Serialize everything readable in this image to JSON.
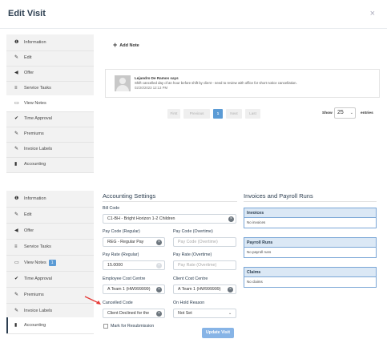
{
  "modal": {
    "title": "Edit Visit",
    "close": "×"
  },
  "sidebar_top": {
    "items": [
      {
        "icon": "info-icon",
        "glyph": "❶",
        "label": "Information"
      },
      {
        "icon": "pencil-icon",
        "glyph": "✎",
        "label": "Edit"
      },
      {
        "icon": "offer-icon",
        "glyph": "◀",
        "label": "Offer"
      },
      {
        "icon": "list-icon",
        "glyph": "≡",
        "label": "Service Tasks"
      },
      {
        "icon": "comments-icon",
        "glyph": "▭",
        "label": "View Notes"
      },
      {
        "icon": "check-icon",
        "glyph": "✔",
        "label": "Time Approval"
      },
      {
        "icon": "pencil-icon",
        "glyph": "✎",
        "label": "Premiums"
      },
      {
        "icon": "pencil-icon",
        "glyph": "✎",
        "label": "Invoice Labels"
      },
      {
        "icon": "bar-chart-icon",
        "glyph": "▮",
        "label": "Accounting"
      }
    ],
    "active_index": 4
  },
  "notes": {
    "add_label": "Add Note",
    "author": "Lejandro De Ramos says",
    "text": "Shift cancelled day of an hour before shift by client - need to review with office for short notice cancellation.",
    "date": "02/20/2023 12:13 PM"
  },
  "pagination": {
    "first": "First",
    "previous": "Previous",
    "current": "1",
    "next": "Next",
    "last": "Last",
    "show_label": "Show",
    "page_size": "25",
    "entries_label": "entries"
  },
  "sidebar_bottom": {
    "items": [
      {
        "icon": "info-icon",
        "glyph": "❶",
        "label": "Information"
      },
      {
        "icon": "pencil-icon",
        "glyph": "✎",
        "label": "Edit"
      },
      {
        "icon": "offer-icon",
        "glyph": "◀",
        "label": "Offer"
      },
      {
        "icon": "list-icon",
        "glyph": "≡",
        "label": "Service Tasks"
      },
      {
        "icon": "comments-icon",
        "glyph": "▭",
        "label": "View Notes",
        "badge": "1"
      },
      {
        "icon": "check-icon",
        "glyph": "✔",
        "label": "Time Approval"
      },
      {
        "icon": "pencil-icon",
        "glyph": "✎",
        "label": "Premiums"
      },
      {
        "icon": "pencil-icon",
        "glyph": "✎",
        "label": "Invoice Labels"
      },
      {
        "icon": "bar-chart-icon",
        "glyph": "▮",
        "label": "Accounting"
      }
    ],
    "active_index": 8
  },
  "accounting": {
    "title": "Accounting Settings",
    "bill_code_label": "Bill Code",
    "bill_code_value": "C1-BH - Bright Horizon 1-2 Children",
    "pay_code_regular_label": "Pay Code (Regular)",
    "pay_code_regular_value": "REG - Regular Pay",
    "pay_code_overtime_label": "Pay Code (Overtime)",
    "pay_code_overtime_placeholder": "Pay Code (Overtime)",
    "pay_rate_regular_label": "Pay Rate (Regular)",
    "pay_rate_regular_value": "15.0000",
    "pay_rate_overtime_label": "Pay Rate (Overtime)",
    "pay_rate_overtime_placeholder": "Pay Rate (Overtime)",
    "employee_cost_centre_label": "Employee Cost Centre",
    "employee_cost_centre_value": "A Team 1 (HW999999)",
    "client_cost_centre_label": "Client Cost Centre",
    "client_cost_centre_value": "A Team 1 (HW999999)",
    "cancelled_code_label": "Cancelled Code",
    "cancelled_code_value": "Client Declined for the",
    "on_hold_reason_label": "On Hold Reason",
    "on_hold_reason_value": "Not Set",
    "resubmission_label": "Mark for Resubmission",
    "update_button": "Update Visit"
  },
  "invoices": {
    "title": "Invoices and Payroll Runs",
    "invoices_header": "Invoices",
    "invoices_empty": "No invoices",
    "payroll_header": "Payroll Runs",
    "payroll_empty": "No payroll runs",
    "claims_header": "Claims",
    "claims_empty": "No claims"
  },
  "colors": {
    "accent": "#5b9bd5",
    "panel_border": "#7aa6d6",
    "panel_header": "#dbe8f5",
    "arrow": "#e53935",
    "sidebar_bg": "#f2f2f2"
  }
}
